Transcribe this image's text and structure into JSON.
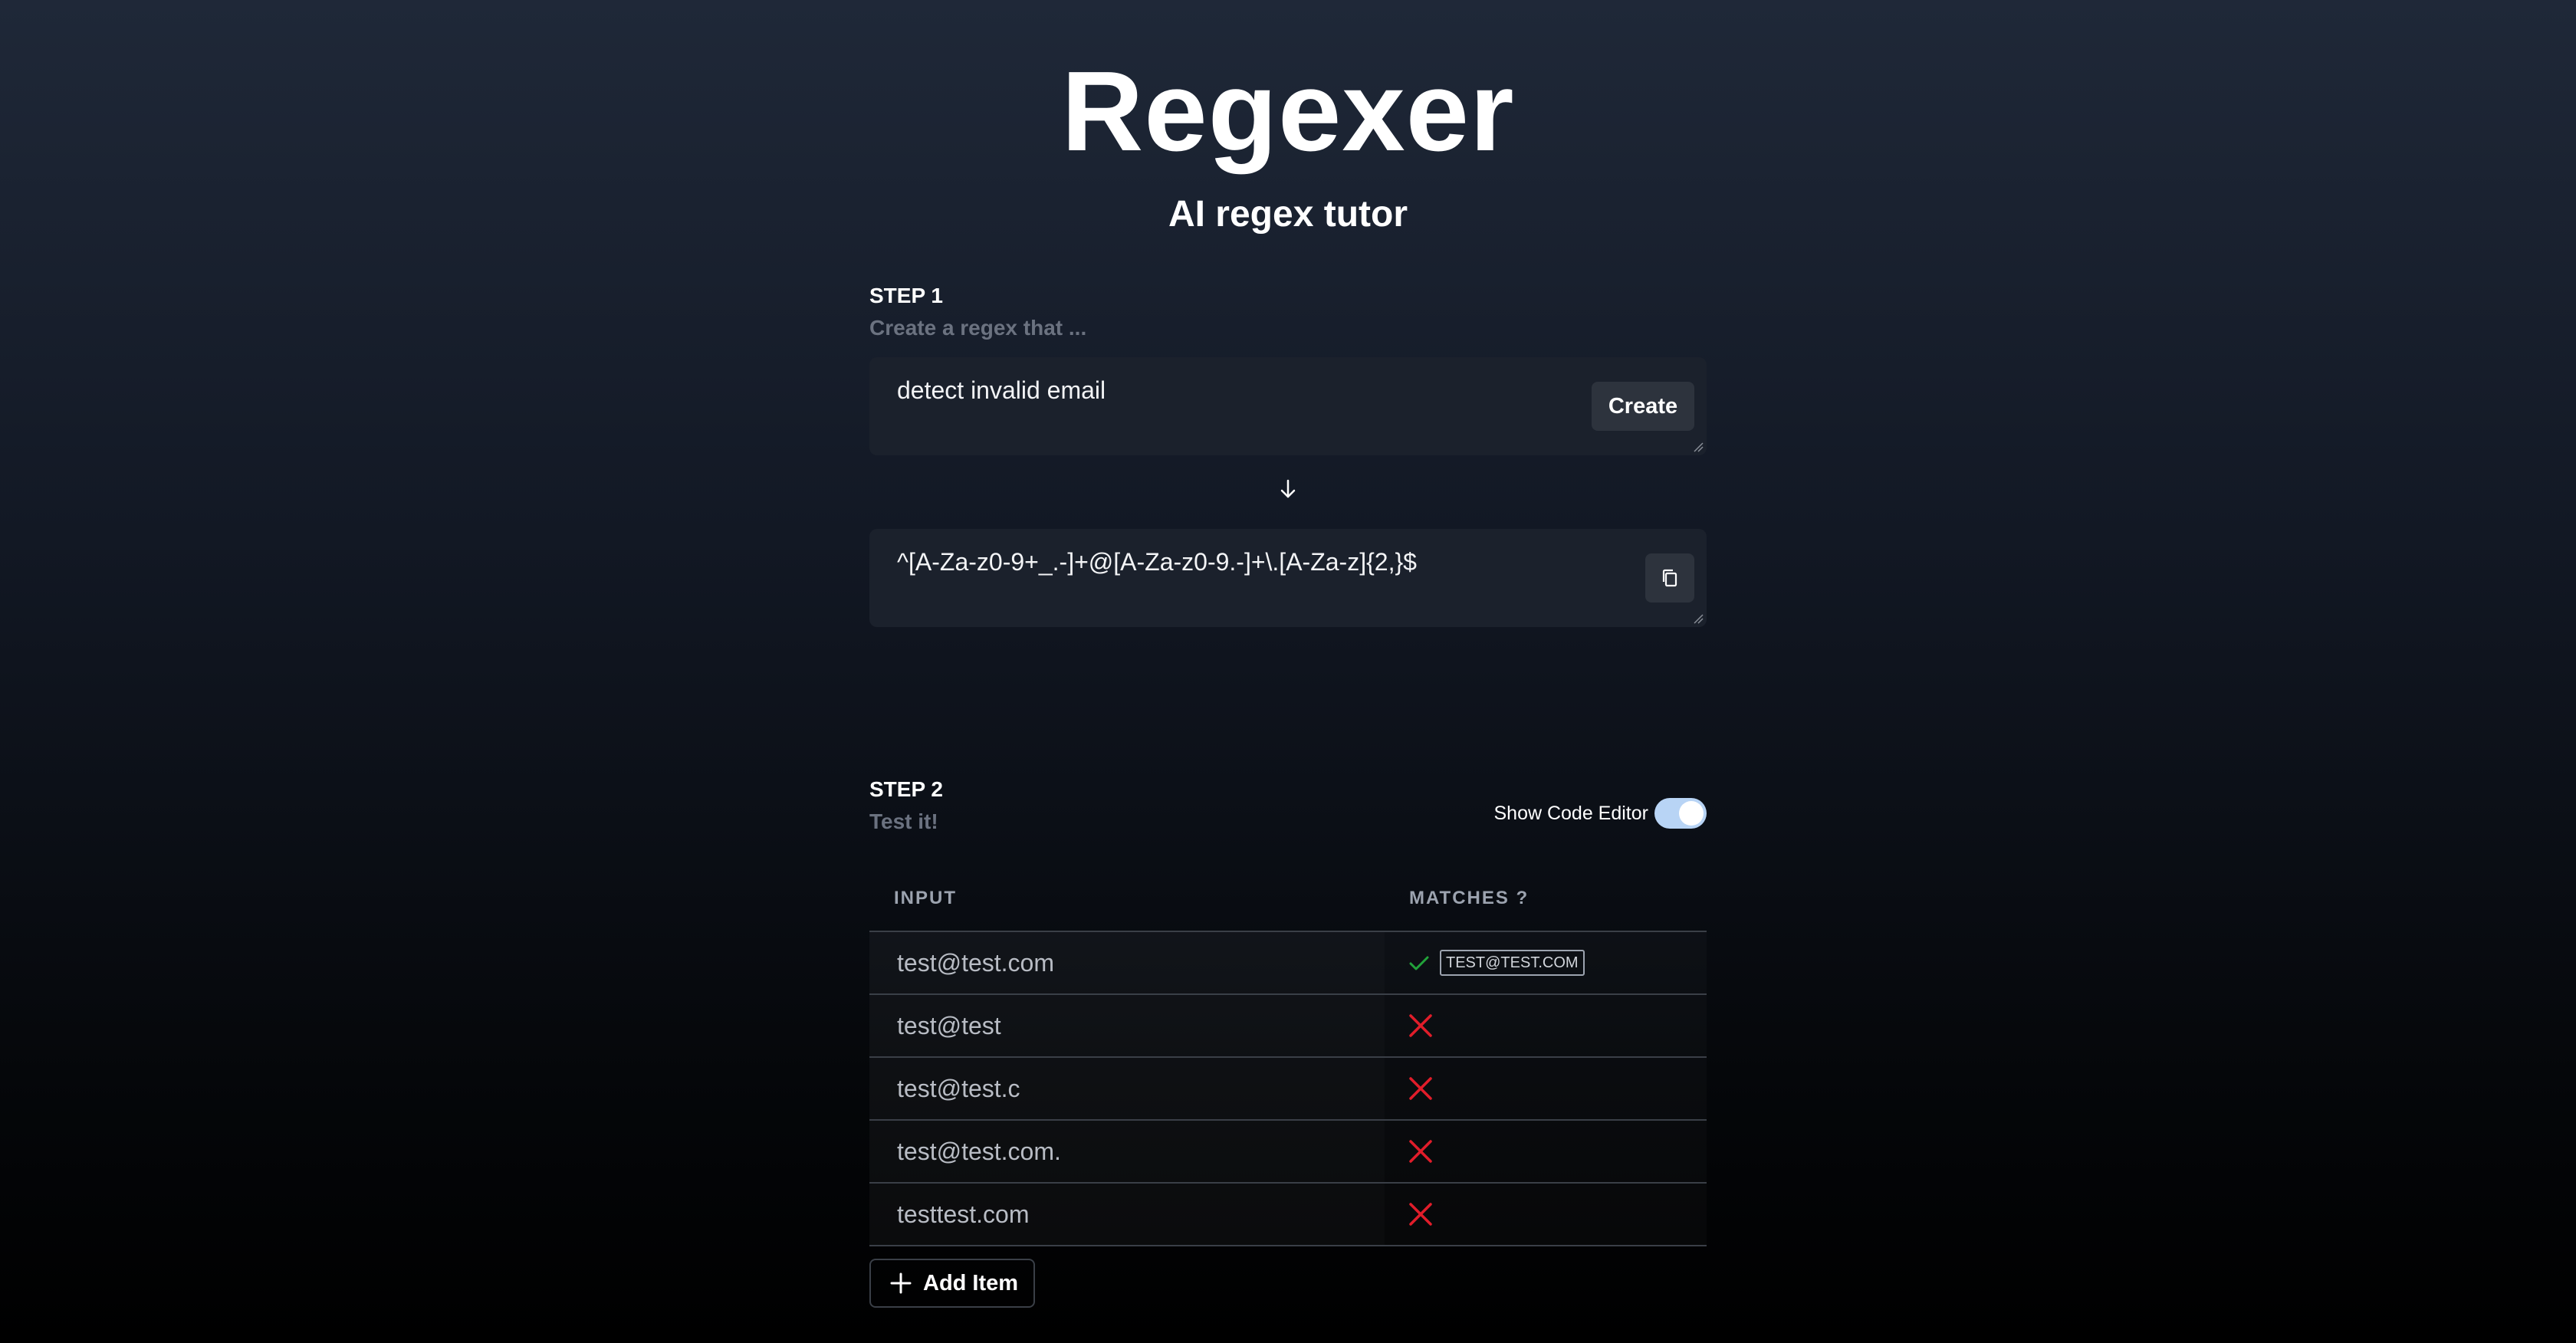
{
  "header": {
    "title": "Regexer",
    "subtitle": "AI regex tutor"
  },
  "step1": {
    "label": "STEP 1",
    "description": "Create a regex that ...",
    "prompt_value": "detect invalid email",
    "create_label": "Create",
    "regex_value": "^[A-Za-z0-9+_.-]+@[A-Za-z0-9.-]+\\.[A-Za-z]{2,}$",
    "icons": {
      "arrow": "arrow-down-icon",
      "copy": "copy-icon"
    }
  },
  "step2": {
    "label": "STEP 2",
    "description": "Test it!",
    "toggle_label": "Show Code Editor",
    "toggle_on": true,
    "toggle_color": "#b8d4f5",
    "table": {
      "headers": [
        "INPUT",
        "MATCHES ?"
      ],
      "rows": [
        {
          "input": "test@test.com",
          "matches": true,
          "match_text": "TEST@TEST.COM"
        },
        {
          "input": "test@test",
          "matches": false,
          "match_text": ""
        },
        {
          "input": "test@test.c",
          "matches": false,
          "match_text": ""
        },
        {
          "input": "test@test.com.",
          "matches": false,
          "match_text": ""
        },
        {
          "input": "testtest.com",
          "matches": false,
          "match_text": ""
        }
      ]
    },
    "add_item_label": "Add Item"
  },
  "colors": {
    "match_yes": "#22a33a",
    "match_no": "#e11d2a"
  }
}
